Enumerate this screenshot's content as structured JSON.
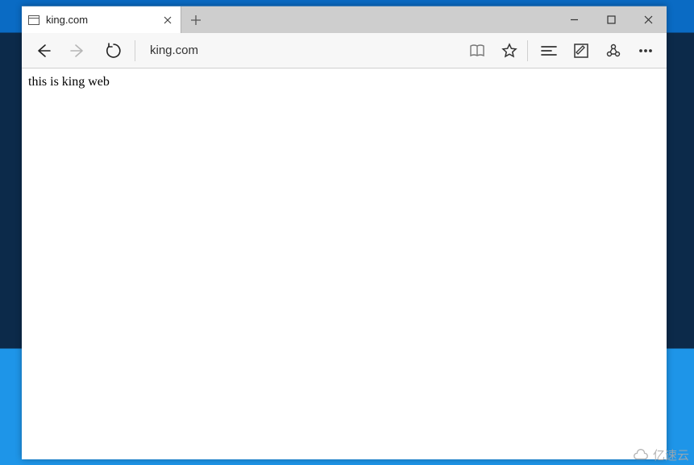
{
  "tab": {
    "title": "king.com"
  },
  "address": {
    "url": "king.com"
  },
  "page": {
    "body_text": "this is king web"
  },
  "watermark": {
    "text": "亿速云"
  }
}
